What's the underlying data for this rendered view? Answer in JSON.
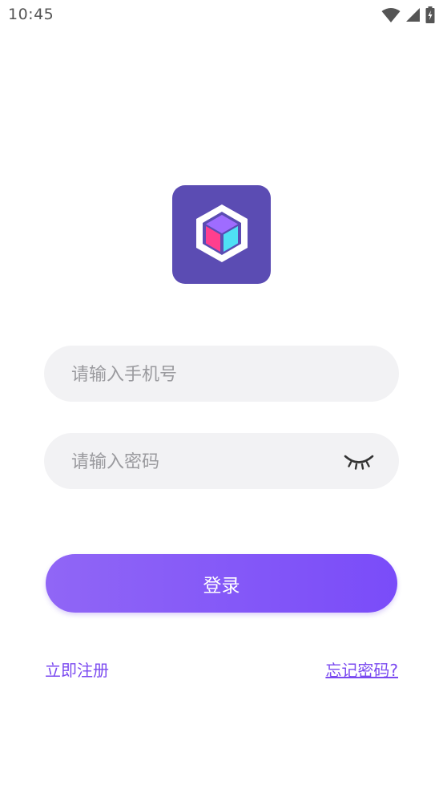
{
  "status_bar": {
    "time": "10:45",
    "icons": [
      "wifi-icon",
      "signal-icon",
      "battery-charging-icon"
    ]
  },
  "logo": {
    "icon": "cube-hexagon-icon",
    "colors": {
      "background": "#5b4cb3",
      "top_face": "#9f6cff",
      "left_face": "#ff3f8e",
      "right_face": "#4fe0f5"
    }
  },
  "form": {
    "phone": {
      "value": "",
      "placeholder": "请输入手机号"
    },
    "password": {
      "value": "",
      "placeholder": "请输入密码",
      "visibility_icon": "eye-closed-icon"
    },
    "login_label": "登录"
  },
  "links": {
    "register": "立即注册",
    "forgot_password": "忘记密码?"
  },
  "colors": {
    "accent": "#7b4af0",
    "button_gradient_start": "#9066f6",
    "button_gradient_end": "#7a4cf9",
    "input_background": "#f2f2f4"
  }
}
